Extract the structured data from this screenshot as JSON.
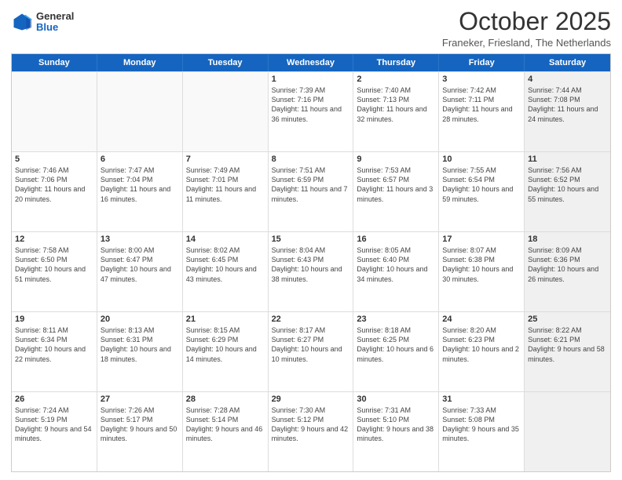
{
  "header": {
    "logo_general": "General",
    "logo_blue": "Blue",
    "month_title": "October 2025",
    "location": "Franeker, Friesland, The Netherlands"
  },
  "days": [
    "Sunday",
    "Monday",
    "Tuesday",
    "Wednesday",
    "Thursday",
    "Friday",
    "Saturday"
  ],
  "weeks": [
    [
      {
        "day": "",
        "empty": true
      },
      {
        "day": "",
        "empty": true
      },
      {
        "day": "",
        "empty": true
      },
      {
        "day": "1",
        "sunrise": "Sunrise: 7:39 AM",
        "sunset": "Sunset: 7:16 PM",
        "daylight": "Daylight: 11 hours and 36 minutes."
      },
      {
        "day": "2",
        "sunrise": "Sunrise: 7:40 AM",
        "sunset": "Sunset: 7:13 PM",
        "daylight": "Daylight: 11 hours and 32 minutes."
      },
      {
        "day": "3",
        "sunrise": "Sunrise: 7:42 AM",
        "sunset": "Sunset: 7:11 PM",
        "daylight": "Daylight: 11 hours and 28 minutes."
      },
      {
        "day": "4",
        "sunrise": "Sunrise: 7:44 AM",
        "sunset": "Sunset: 7:08 PM",
        "daylight": "Daylight: 11 hours and 24 minutes.",
        "shaded": true
      }
    ],
    [
      {
        "day": "5",
        "sunrise": "Sunrise: 7:46 AM",
        "sunset": "Sunset: 7:06 PM",
        "daylight": "Daylight: 11 hours and 20 minutes."
      },
      {
        "day": "6",
        "sunrise": "Sunrise: 7:47 AM",
        "sunset": "Sunset: 7:04 PM",
        "daylight": "Daylight: 11 hours and 16 minutes."
      },
      {
        "day": "7",
        "sunrise": "Sunrise: 7:49 AM",
        "sunset": "Sunset: 7:01 PM",
        "daylight": "Daylight: 11 hours and 11 minutes."
      },
      {
        "day": "8",
        "sunrise": "Sunrise: 7:51 AM",
        "sunset": "Sunset: 6:59 PM",
        "daylight": "Daylight: 11 hours and 7 minutes."
      },
      {
        "day": "9",
        "sunrise": "Sunrise: 7:53 AM",
        "sunset": "Sunset: 6:57 PM",
        "daylight": "Daylight: 11 hours and 3 minutes."
      },
      {
        "day": "10",
        "sunrise": "Sunrise: 7:55 AM",
        "sunset": "Sunset: 6:54 PM",
        "daylight": "Daylight: 10 hours and 59 minutes."
      },
      {
        "day": "11",
        "sunrise": "Sunrise: 7:56 AM",
        "sunset": "Sunset: 6:52 PM",
        "daylight": "Daylight: 10 hours and 55 minutes.",
        "shaded": true
      }
    ],
    [
      {
        "day": "12",
        "sunrise": "Sunrise: 7:58 AM",
        "sunset": "Sunset: 6:50 PM",
        "daylight": "Daylight: 10 hours and 51 minutes."
      },
      {
        "day": "13",
        "sunrise": "Sunrise: 8:00 AM",
        "sunset": "Sunset: 6:47 PM",
        "daylight": "Daylight: 10 hours and 47 minutes."
      },
      {
        "day": "14",
        "sunrise": "Sunrise: 8:02 AM",
        "sunset": "Sunset: 6:45 PM",
        "daylight": "Daylight: 10 hours and 43 minutes."
      },
      {
        "day": "15",
        "sunrise": "Sunrise: 8:04 AM",
        "sunset": "Sunset: 6:43 PM",
        "daylight": "Daylight: 10 hours and 38 minutes."
      },
      {
        "day": "16",
        "sunrise": "Sunrise: 8:05 AM",
        "sunset": "Sunset: 6:40 PM",
        "daylight": "Daylight: 10 hours and 34 minutes."
      },
      {
        "day": "17",
        "sunrise": "Sunrise: 8:07 AM",
        "sunset": "Sunset: 6:38 PM",
        "daylight": "Daylight: 10 hours and 30 minutes."
      },
      {
        "day": "18",
        "sunrise": "Sunrise: 8:09 AM",
        "sunset": "Sunset: 6:36 PM",
        "daylight": "Daylight: 10 hours and 26 minutes.",
        "shaded": true
      }
    ],
    [
      {
        "day": "19",
        "sunrise": "Sunrise: 8:11 AM",
        "sunset": "Sunset: 6:34 PM",
        "daylight": "Daylight: 10 hours and 22 minutes."
      },
      {
        "day": "20",
        "sunrise": "Sunrise: 8:13 AM",
        "sunset": "Sunset: 6:31 PM",
        "daylight": "Daylight: 10 hours and 18 minutes."
      },
      {
        "day": "21",
        "sunrise": "Sunrise: 8:15 AM",
        "sunset": "Sunset: 6:29 PM",
        "daylight": "Daylight: 10 hours and 14 minutes."
      },
      {
        "day": "22",
        "sunrise": "Sunrise: 8:17 AM",
        "sunset": "Sunset: 6:27 PM",
        "daylight": "Daylight: 10 hours and 10 minutes."
      },
      {
        "day": "23",
        "sunrise": "Sunrise: 8:18 AM",
        "sunset": "Sunset: 6:25 PM",
        "daylight": "Daylight: 10 hours and 6 minutes."
      },
      {
        "day": "24",
        "sunrise": "Sunrise: 8:20 AM",
        "sunset": "Sunset: 6:23 PM",
        "daylight": "Daylight: 10 hours and 2 minutes."
      },
      {
        "day": "25",
        "sunrise": "Sunrise: 8:22 AM",
        "sunset": "Sunset: 6:21 PM",
        "daylight": "Daylight: 9 hours and 58 minutes.",
        "shaded": true
      }
    ],
    [
      {
        "day": "26",
        "sunrise": "Sunrise: 7:24 AM",
        "sunset": "Sunset: 5:19 PM",
        "daylight": "Daylight: 9 hours and 54 minutes."
      },
      {
        "day": "27",
        "sunrise": "Sunrise: 7:26 AM",
        "sunset": "Sunset: 5:17 PM",
        "daylight": "Daylight: 9 hours and 50 minutes."
      },
      {
        "day": "28",
        "sunrise": "Sunrise: 7:28 AM",
        "sunset": "Sunset: 5:14 PM",
        "daylight": "Daylight: 9 hours and 46 minutes."
      },
      {
        "day": "29",
        "sunrise": "Sunrise: 7:30 AM",
        "sunset": "Sunset: 5:12 PM",
        "daylight": "Daylight: 9 hours and 42 minutes."
      },
      {
        "day": "30",
        "sunrise": "Sunrise: 7:31 AM",
        "sunset": "Sunset: 5:10 PM",
        "daylight": "Daylight: 9 hours and 38 minutes."
      },
      {
        "day": "31",
        "sunrise": "Sunrise: 7:33 AM",
        "sunset": "Sunset: 5:08 PM",
        "daylight": "Daylight: 9 hours and 35 minutes."
      },
      {
        "day": "",
        "empty": true,
        "shaded": true
      }
    ]
  ]
}
